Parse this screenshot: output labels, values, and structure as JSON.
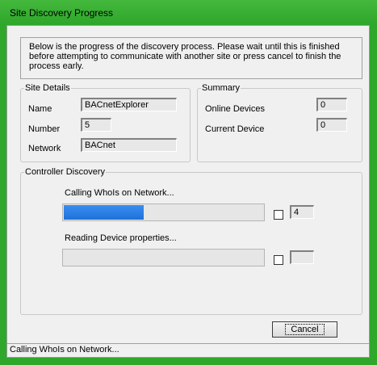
{
  "window": {
    "title": "Site Discovery Progress",
    "accent_color": "#2ea72b"
  },
  "info": {
    "message": "Below is the progress of the discovery process. Please wait until this is finished before attempting to communicate with another site or press cancel to finish the process early."
  },
  "site_details": {
    "legend": "Site Details",
    "name_label": "Name",
    "name_value": "BACnetExplorer",
    "number_label": "Number",
    "number_value": "5",
    "network_label": "Network",
    "network_value": "BACnet"
  },
  "summary": {
    "legend": "Summary",
    "online_devices_label": "Online Devices",
    "online_devices_value": "0",
    "current_device_label": "Current Device",
    "current_device_value": "0"
  },
  "controller_discovery": {
    "legend": "Controller Discovery",
    "whois_label": "Calling WhoIs on Network...",
    "whois_progress": 0.4,
    "whois_checked": false,
    "whois_count": "4",
    "props_label": "Reading Device properties...",
    "props_progress": 0.0,
    "props_checked": false,
    "props_count": "",
    "progress_color": "#1f71d8"
  },
  "buttons": {
    "cancel_label": "Cancel"
  },
  "status": {
    "text": "Calling WhoIs on Network..."
  }
}
